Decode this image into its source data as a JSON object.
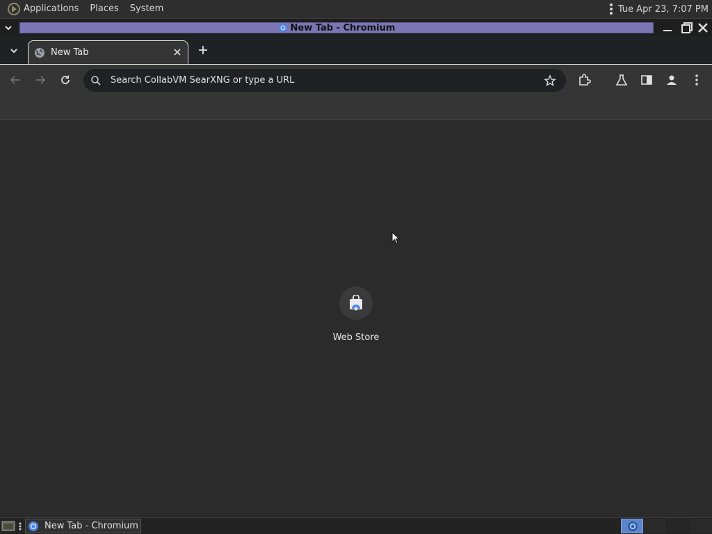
{
  "top_panel": {
    "menu": [
      "Applications",
      "Places",
      "System"
    ],
    "clock": "Tue Apr 23,  7:07 PM"
  },
  "window": {
    "title": "New Tab - Chromium"
  },
  "tabs": [
    {
      "label": "New Tab",
      "icon": "globe-icon"
    }
  ],
  "toolbar": {
    "omnibox_placeholder": "Search CollabVM SearXNG or type a URL"
  },
  "content": {
    "shortcuts": [
      {
        "label": "Web Store",
        "icon": "web-store-icon"
      }
    ]
  },
  "taskbar": {
    "task_label": "New Tab - Chromium"
  },
  "colors": {
    "title_strip": "#7b76b3",
    "chrome_blue": "#4a86e8",
    "background": "#2b2b2b"
  }
}
